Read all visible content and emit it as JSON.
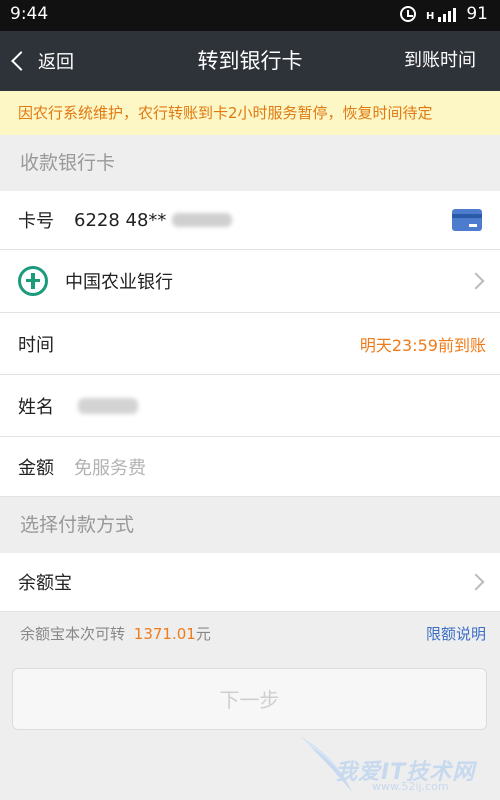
{
  "status_bar": {
    "time": "9:44",
    "signal": "H",
    "battery": "91"
  },
  "nav": {
    "back_label": "返回",
    "title": "转到银行卡",
    "right_action": "到账时间"
  },
  "notice": "因农行系统维护，农行转账到卡2小时服务暂停，恢复时间待定",
  "section_bank_card": "收款银行卡",
  "card_row": {
    "label": "卡号",
    "value": "6228 48**"
  },
  "bank_row": {
    "name": "中国农业银行"
  },
  "time_row": {
    "label": "时间",
    "value": "明天23:59前到账"
  },
  "name_row": {
    "label": "姓名"
  },
  "amount_row": {
    "label": "金额",
    "placeholder": "免服务费"
  },
  "section_payment": "选择付款方式",
  "payment_row": {
    "label": "余额宝"
  },
  "balance": {
    "prefix": "余额宝本次可转",
    "amount": "1371.01",
    "suffix": "元",
    "limit_link": "限额说明"
  },
  "next_button": "下一步",
  "watermark": {
    "text": "我爱IT技术网",
    "sub": "www.52ij.com"
  },
  "colors": {
    "nav_bg": "#2e3239",
    "notice_bg": "#fdf6c5",
    "notice_text": "#e07a12",
    "accent_orange": "#ef7b1a",
    "link_blue": "#3a6fc4",
    "abc_green": "#1a9b7b"
  }
}
